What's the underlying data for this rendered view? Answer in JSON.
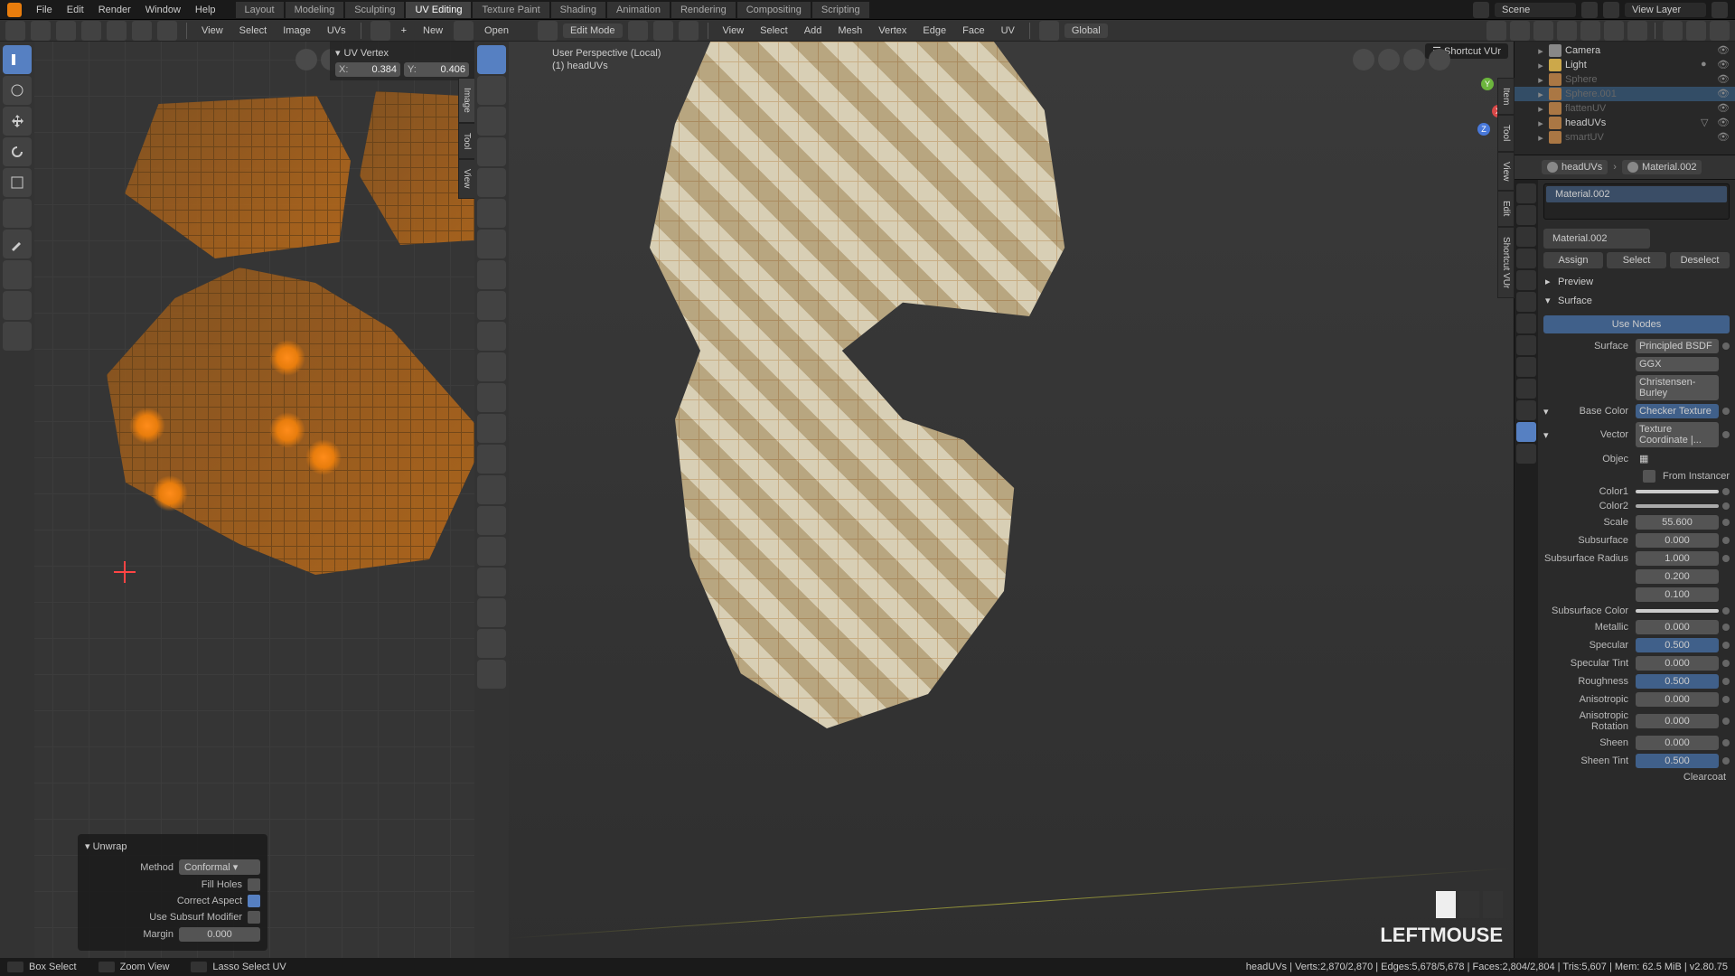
{
  "topbar": {
    "menus": [
      "File",
      "Edit",
      "Render",
      "Window",
      "Help"
    ],
    "workspaces": [
      "Layout",
      "Modeling",
      "Sculpting",
      "UV Editing",
      "Texture Paint",
      "Shading",
      "Animation",
      "Rendering",
      "Compositing",
      "Scripting"
    ],
    "active_workspace": "UV Editing",
    "scene": "Scene",
    "viewlayer": "View Layer"
  },
  "uv_header": {
    "menus": [
      "View",
      "Select",
      "Image",
      "UVs"
    ],
    "new": "New",
    "open": "Open"
  },
  "uv_vertex_panel": {
    "title": "UV Vertex",
    "x_label": "X:",
    "x_value": "0.384",
    "y_label": "Y:",
    "y_value": "0.406"
  },
  "uv_side_tabs": [
    "Image",
    "Tool",
    "View"
  ],
  "uv_op": {
    "title": "Unwrap",
    "method_label": "Method",
    "method_value": "Conformal",
    "fill_holes": "Fill Holes",
    "correct_aspect": "Correct Aspect",
    "use_subsurf": "Use Subsurf Modifier",
    "margin_label": "Margin",
    "margin_value": "0.000"
  },
  "vp_header": {
    "mode": "Edit Mode",
    "menus": [
      "View",
      "Select",
      "Add",
      "Mesh",
      "Vertex",
      "Edge",
      "Face",
      "UV"
    ],
    "orientation": "Global"
  },
  "vp_info": {
    "line1": "User Perspective (Local)",
    "line2": "(1) headUVs"
  },
  "vp_shortcut": "Shortcut VUr",
  "vp_side_tabs": [
    "Item",
    "Tool",
    "View",
    "Edit",
    "Shortcut VUr"
  ],
  "vp_hud_label": "LEFTMOUSE",
  "outliner": [
    {
      "name": "Camera",
      "icon": "cam",
      "dim": false,
      "sel": false
    },
    {
      "name": "Light",
      "icon": "light",
      "dim": false,
      "sel": false
    },
    {
      "name": "Sphere",
      "icon": "mesh",
      "dim": true,
      "sel": false
    },
    {
      "name": "Sphere.001",
      "icon": "mesh",
      "dim": true,
      "sel": true
    },
    {
      "name": "flattenUV",
      "icon": "mesh",
      "dim": true,
      "sel": false
    },
    {
      "name": "headUVs",
      "icon": "mesh",
      "dim": false,
      "sel": false
    },
    {
      "name": "smartUV",
      "icon": "mesh",
      "dim": true,
      "sel": false
    }
  ],
  "mat_header": {
    "object": "headUVs",
    "material": "Material.002"
  },
  "mat_slot": "Material.002",
  "mat_field": "Material.002",
  "mat_buttons": {
    "assign": "Assign",
    "select": "Select",
    "deselect": "Deselect"
  },
  "panels": {
    "preview": "Preview",
    "surface": "Surface",
    "use_nodes": "Use Nodes"
  },
  "surface": {
    "shader_label": "Surface",
    "shader": "Principled BSDF",
    "dist": "GGX",
    "sss_method": "Christensen-Burley",
    "basecolor_label": "Base Color",
    "basecolor": "Checker Texture",
    "vector_label": "Vector",
    "vector": "Texture Coordinate |...",
    "object_label": "Objec",
    "from_instancer": "From Instancer",
    "color1_label": "Color1",
    "color2_label": "Color2",
    "scale_label": "Scale",
    "scale": "55.600",
    "subsurface_label": "Subsurface",
    "subsurface": "0.000",
    "subsurface_radius_label": "Subsurface Radius",
    "subsurface_radius": [
      "1.000",
      "0.200",
      "0.100"
    ],
    "subsurface_color_label": "Subsurface Color",
    "metallic_label": "Metallic",
    "metallic": "0.000",
    "specular_label": "Specular",
    "specular": "0.500",
    "specular_tint_label": "Specular Tint",
    "specular_tint": "0.000",
    "roughness_label": "Roughness",
    "roughness": "0.500",
    "anisotropic_label": "Anisotropic",
    "anisotropic": "0.000",
    "aniso_rot_label": "Anisotropic Rotation",
    "aniso_rot": "0.000",
    "sheen_label": "Sheen",
    "sheen": "0.000",
    "sheen_tint_label": "Sheen Tint",
    "sheen_tint": "0.500",
    "clearcoat_label": "Clearcoat"
  },
  "statusbar": {
    "left_items": [
      "Box Select",
      "Zoom View",
      "Lasso Select UV"
    ],
    "right": "headUVs | Verts:2,870/2,870 | Edges:5,678/5,678 | Faces:2,804/2,804 | Tris:5,607 | Mem: 62.5 MiB | v2.80.75"
  }
}
